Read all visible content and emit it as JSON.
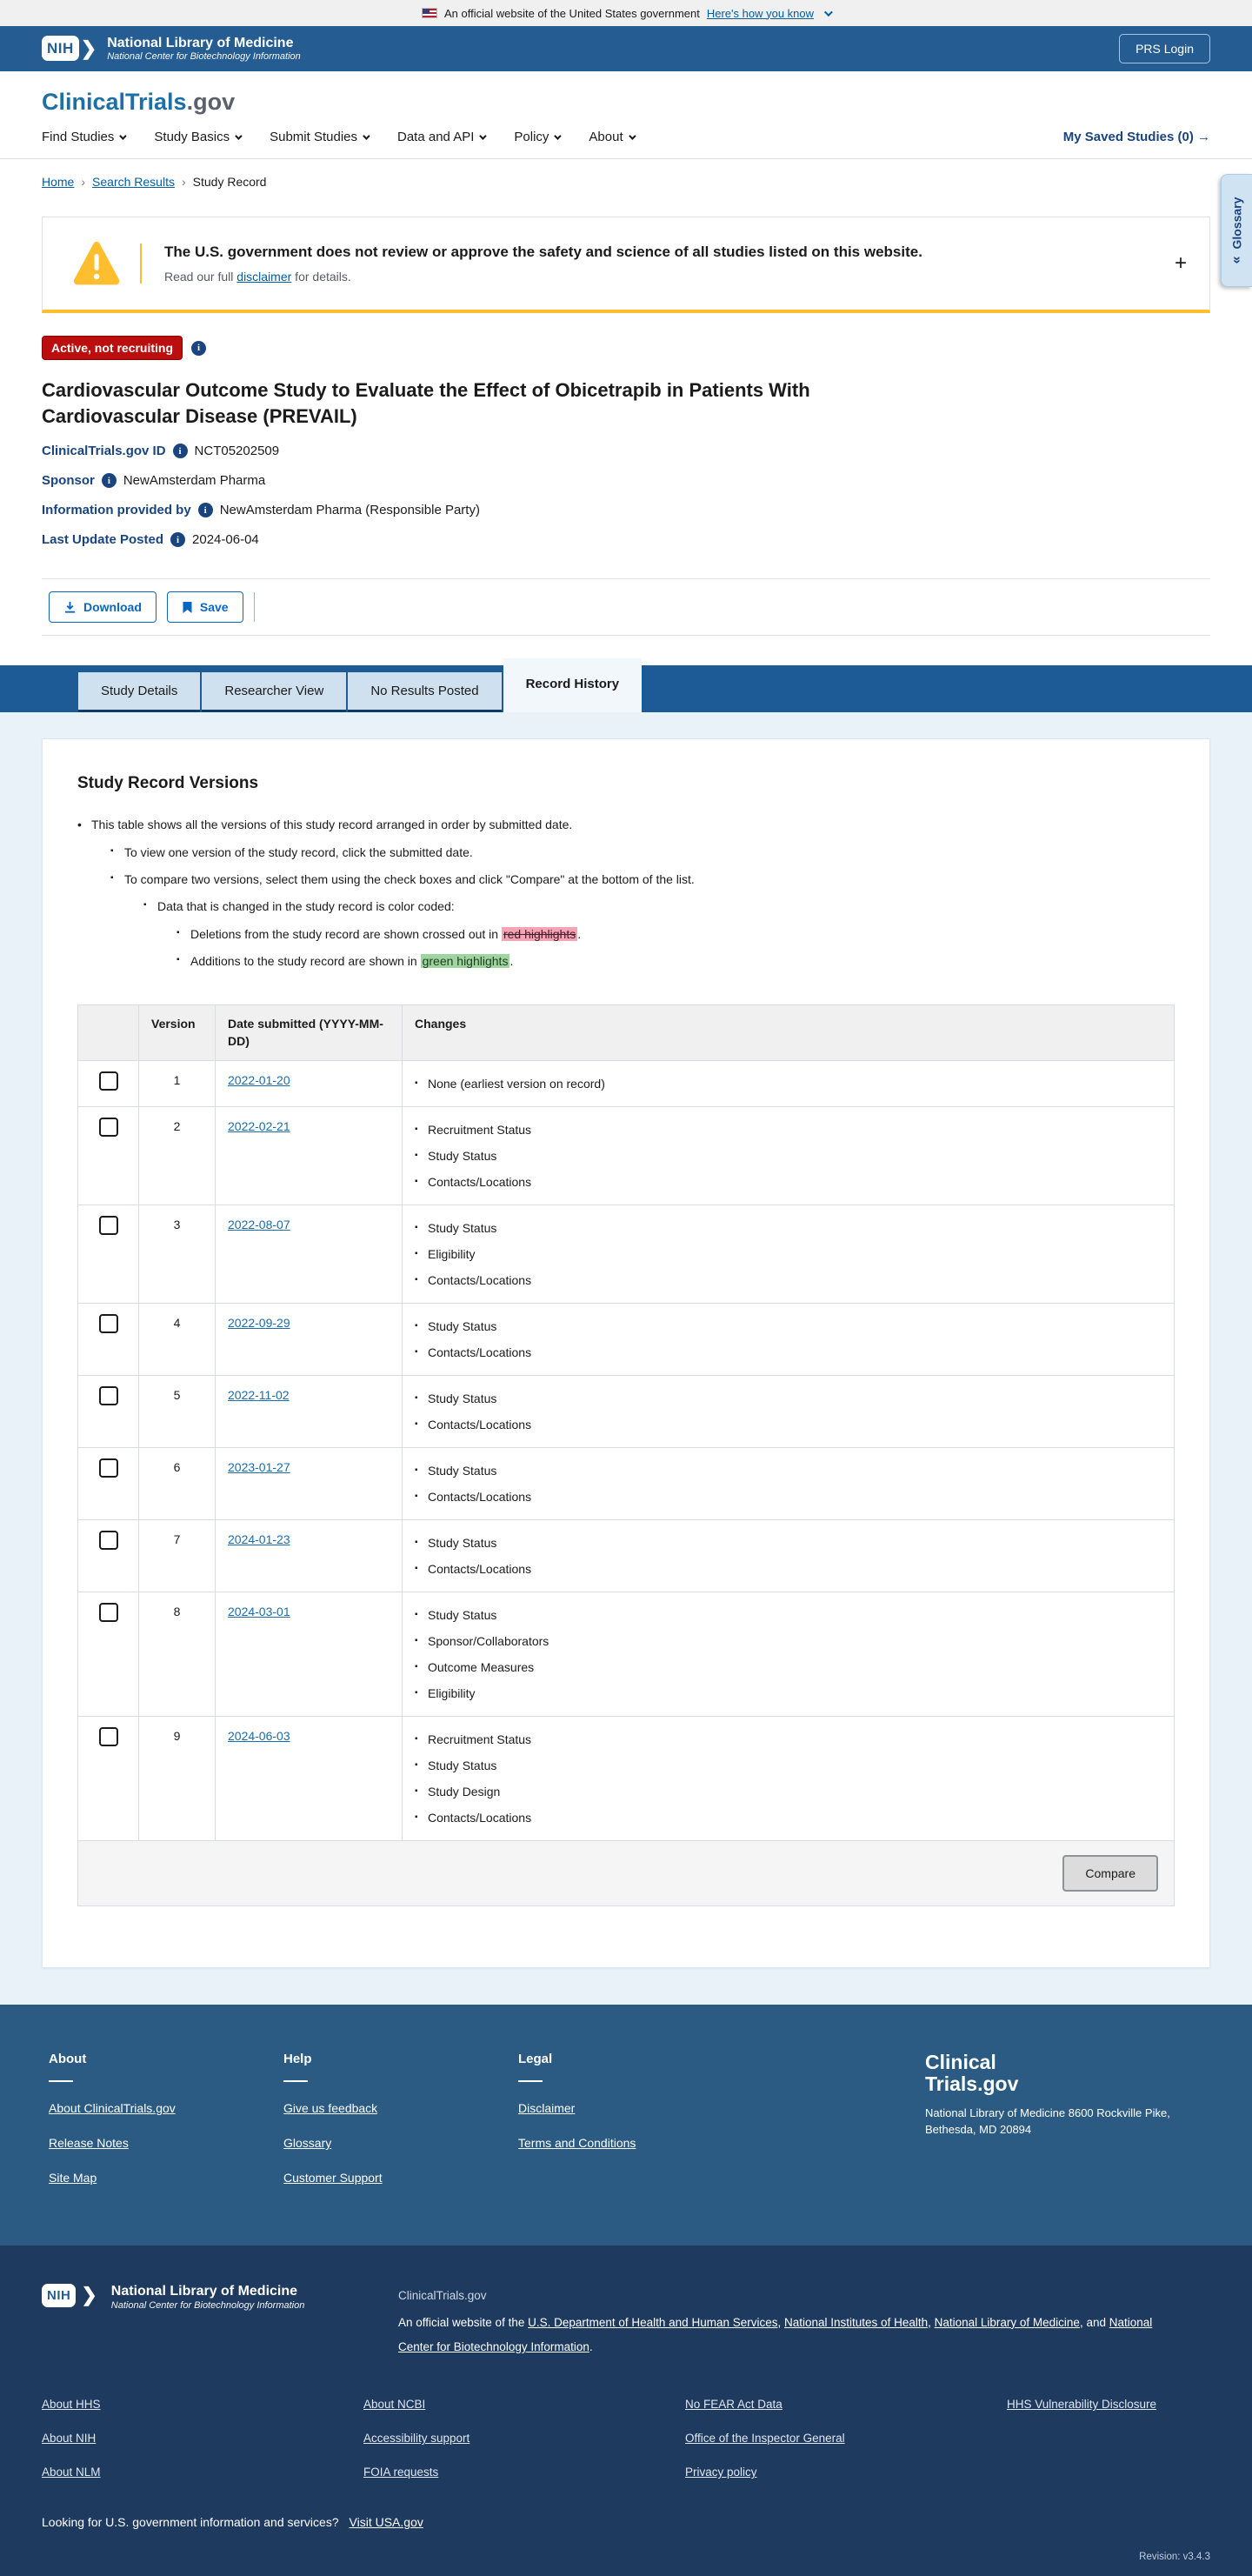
{
  "banner": {
    "text": "An official website of the United States government",
    "link": "Here's how you know"
  },
  "header": {
    "nih_acronym": "NIH",
    "org": "National Library of Medicine",
    "org_sub": "National Center for Biotechnology Information",
    "prs_login": "PRS Login"
  },
  "site": {
    "logo_primary": "ClinicalTrials",
    "logo_suffix": ".gov"
  },
  "nav": {
    "items": [
      "Find Studies",
      "Study Basics",
      "Submit Studies",
      "Data and API",
      "Policy",
      "About"
    ],
    "saved": "My Saved Studies (0)"
  },
  "breadcrumb": [
    "Home",
    "Search Results",
    "Study Record"
  ],
  "glossary": {
    "label": "Glossary",
    "collapse_icon": "«"
  },
  "warning": {
    "title": "The U.S. government does not review or approve the safety and science of all studies listed on this website.",
    "sub_pre": "Read our full ",
    "sub_link": "disclaimer",
    "sub_post": " for details.",
    "expand": "+"
  },
  "study": {
    "status": "Active, not recruiting",
    "title": "Cardiovascular Outcome Study to Evaluate the Effect of Obicetrapib in Patients With Cardiovascular Disease (PREVAIL)",
    "meta": [
      {
        "label": "ClinicalTrials.gov ID",
        "value": "NCT05202509"
      },
      {
        "label": "Sponsor",
        "value": "NewAmsterdam Pharma"
      },
      {
        "label": "Information provided by",
        "value": "NewAmsterdam Pharma (Responsible Party)"
      },
      {
        "label": "Last Update Posted",
        "value": "2024-06-04"
      }
    ]
  },
  "actions": {
    "download": "Download",
    "save": "Save"
  },
  "tabs": [
    {
      "label": "Study Details",
      "active": false
    },
    {
      "label": "Researcher View",
      "active": false
    },
    {
      "label": "No Results Posted",
      "active": false
    },
    {
      "label": "Record History",
      "active": true
    }
  ],
  "versions": {
    "heading": "Study Record Versions",
    "note1": "This table shows all the versions of this study record arranged in order by submitted date.",
    "note1a": "To view one version of the study record, click the submitted date.",
    "note1b": "To compare two versions, select them using the check boxes and click \"Compare\" at the bottom of the list.",
    "note2": "Data that is changed in the study record is color coded:",
    "red_pre": "Deletions from the study record are shown crossed out in ",
    "red_hl": "red highlights",
    "red_post": ".",
    "green_pre": "Additions to the study record are shown in ",
    "green_hl": "green highlights",
    "green_post": ".",
    "table": {
      "headers": [
        "",
        "Version",
        "Date submitted (YYYY-MM-DD)",
        "Changes"
      ],
      "rows": [
        {
          "version": "1",
          "date": "2022-01-20",
          "changes": [
            "None (earliest version on record)"
          ]
        },
        {
          "version": "2",
          "date": "2022-02-21",
          "changes": [
            "Recruitment Status",
            "Study Status",
            "Contacts/Locations"
          ]
        },
        {
          "version": "3",
          "date": "2022-08-07",
          "changes": [
            "Study Status",
            "Eligibility",
            "Contacts/Locations"
          ]
        },
        {
          "version": "4",
          "date": "2022-09-29",
          "changes": [
            "Study Status",
            "Contacts/Locations"
          ]
        },
        {
          "version": "5",
          "date": "2022-11-02",
          "changes": [
            "Study Status",
            "Contacts/Locations"
          ]
        },
        {
          "version": "6",
          "date": "2023-01-27",
          "changes": [
            "Study Status",
            "Contacts/Locations"
          ]
        },
        {
          "version": "7",
          "date": "2024-01-23",
          "changes": [
            "Study Status",
            "Contacts/Locations"
          ]
        },
        {
          "version": "8",
          "date": "2024-03-01",
          "changes": [
            "Study Status",
            "Sponsor/Collaborators",
            "Outcome Measures",
            "Eligibility"
          ]
        },
        {
          "version": "9",
          "date": "2024-06-03",
          "changes": [
            "Recruitment Status",
            "Study Status",
            "Study Design",
            "Contacts/Locations"
          ]
        }
      ],
      "compare_label": "Compare"
    }
  },
  "footer": {
    "columns": [
      {
        "heading": "About",
        "links": [
          "About ClinicalTrials.gov",
          "Release Notes",
          "Site Map"
        ]
      },
      {
        "heading": "Help",
        "links": [
          "Give us feedback",
          "Glossary",
          "Customer Support"
        ]
      },
      {
        "heading": "Legal",
        "links": [
          "Disclaimer",
          "Terms and Conditions"
        ]
      }
    ],
    "logo_line1": "Clinical",
    "logo_line2": "Trials.gov",
    "address": "National Library of Medicine 8600 Rockville Pike, Bethesda, MD 20894"
  },
  "subfooter": {
    "nih_acronym": "NIH",
    "org": "National Library of Medicine",
    "org_sub": "National Center for Biotechnology Information",
    "ct_label": "ClinicalTrials.gov",
    "agency_line": [
      {
        "t": "An official website of the "
      },
      {
        "t": "U.S. Department of Health and Human Services",
        "link": true
      },
      {
        "t": ", "
      },
      {
        "t": "National Institutes of Health",
        "link": true
      },
      {
        "t": ", "
      },
      {
        "t": "National Library of Medicine",
        "link": true
      },
      {
        "t": ", and "
      },
      {
        "t": "National Center for Biotechnology Information",
        "link": true
      },
      {
        "t": "."
      }
    ],
    "link_columns": [
      [
        "About HHS",
        "About NIH",
        "About NLM"
      ],
      [
        "About NCBI",
        "Accessibility support",
        "FOIA requests"
      ],
      [
        "No FEAR Act Data",
        "Office of the Inspector General",
        "Privacy policy"
      ],
      [
        "HHS Vulnerability Disclosure"
      ]
    ],
    "usa_text": "Looking for U.S. government information and services?",
    "usa_link": "Visit USA.gov",
    "revision": "Revision: v3.4.3"
  }
}
